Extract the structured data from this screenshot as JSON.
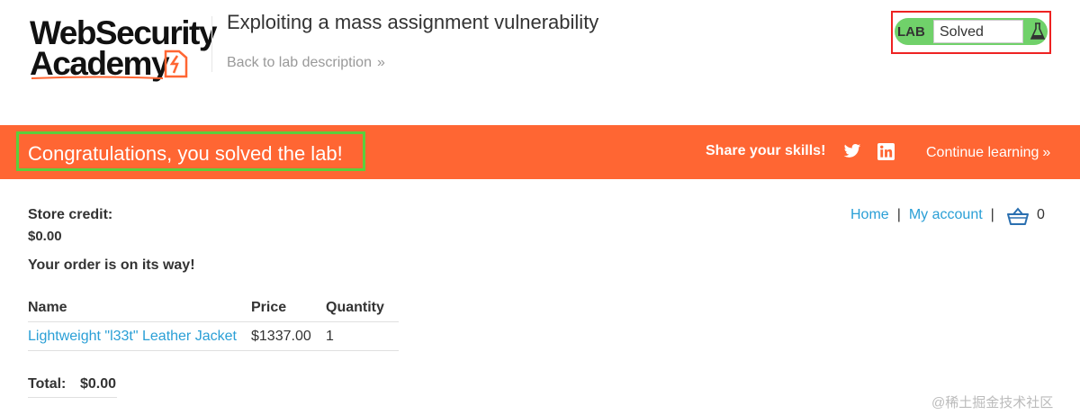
{
  "header": {
    "logo_line1": "WebSecurity",
    "logo_line2": "Academy",
    "lab_title": "Exploiting a mass assignment vulnerability",
    "back_link": "Back to lab description",
    "lab_tag": "LAB",
    "lab_state": "Solved"
  },
  "banner": {
    "message": "Congratulations, you solved the lab!",
    "share_label": "Share your skills!",
    "continue_label": "Continue learning"
  },
  "nav": {
    "home": "Home",
    "separator": "|",
    "my_account": "My account",
    "cart_count": "0"
  },
  "account": {
    "credit_label": "Store credit:",
    "credit_value": "$0.00",
    "order_message": "Your order is on its way!"
  },
  "order_table": {
    "headers": [
      "Name",
      "Price",
      "Quantity"
    ],
    "rows": [
      {
        "name": "Lightweight \"l33t\" Leather Jacket",
        "price": "$1337.00",
        "quantity": "1"
      }
    ],
    "total_label": "Total:",
    "total_value": "$0.00"
  },
  "watermark": "@稀土掘金技术社区",
  "colors": {
    "banner": "#ff6633",
    "solved_green": "#70d16a",
    "link_blue": "#2a9fd6",
    "lab_highlight_border": "#ee2222",
    "congrats_highlight_border": "#5ccf3c"
  }
}
